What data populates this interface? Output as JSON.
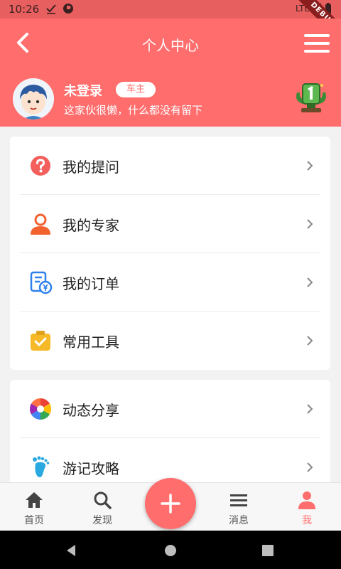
{
  "status_bar": {
    "time": "10:26",
    "network": "LTE",
    "debug_banner": "DEBUG",
    "icons": [
      "check-icon",
      "circle-p-icon",
      "signal-icon",
      "battery-icon"
    ]
  },
  "app_bar": {
    "title": "个人中心",
    "background": "#ff6d6d"
  },
  "profile": {
    "name": "未登录",
    "badge": "车主",
    "signature": "这家伙很懒，什么都没有留下"
  },
  "menu_groups": [
    {
      "items": [
        {
          "label": "我的提问",
          "icon": "question-icon",
          "color": "#f25f5c"
        },
        {
          "label": "我的专家",
          "icon": "person-icon",
          "color": "#f2622e"
        },
        {
          "label": "我的订单",
          "icon": "order-icon",
          "color": "#2f80ed"
        },
        {
          "label": "常用工具",
          "icon": "toolbox-icon",
          "color": "#f6b928"
        }
      ]
    },
    {
      "items": [
        {
          "label": "动态分享",
          "icon": "aperture-icon",
          "color": "#e94235"
        },
        {
          "label": "游记攻略",
          "icon": "footprint-icon",
          "color": "#2aa9e0"
        }
      ]
    }
  ],
  "bottom_nav": {
    "tabs": [
      {
        "label": "首页",
        "icon": "home-icon"
      },
      {
        "label": "发现",
        "icon": "search-icon"
      },
      {
        "label": "消息",
        "icon": "list-icon"
      },
      {
        "label": "我",
        "icon": "person-icon",
        "active": true
      }
    ],
    "fab_icon": "plus-icon",
    "accent": "#ff6d6d"
  }
}
